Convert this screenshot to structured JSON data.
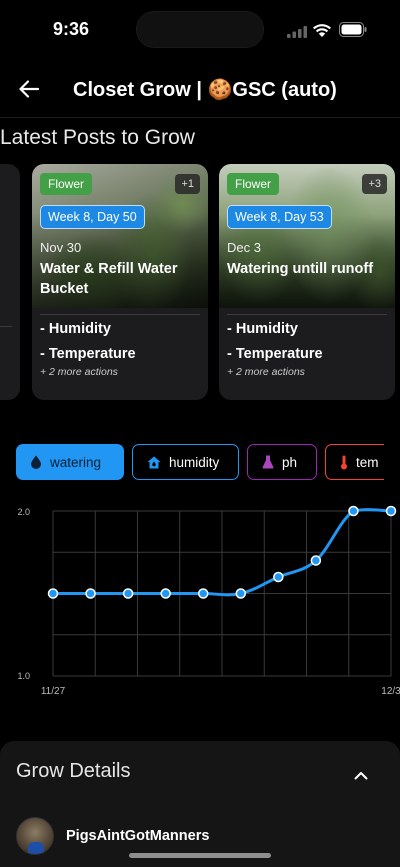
{
  "status_bar": {
    "time": "9:36"
  },
  "header": {
    "title": "Closet Grow | 🍪GSC (auto)"
  },
  "latest_posts": {
    "title": "Latest Posts to Grow",
    "posts": [
      {
        "stage": "Flower",
        "extra_photos": "+1",
        "week_day": "Week 8, Day 50",
        "date": "Nov 30",
        "title": "Water & Refill Water Bucket",
        "actions": [
          "- Humidity",
          "- Temperature"
        ],
        "more_actions": "+ 2 more actions"
      },
      {
        "stage": "Flower",
        "extra_photos": "+3",
        "week_day": "Week 8, Day 53",
        "date": "Dec 3",
        "title": "Watering untill runoff",
        "actions": [
          "- Humidity",
          "- Temperature"
        ],
        "more_actions": "+ 2 more actions"
      }
    ]
  },
  "metric_chips": [
    {
      "label": "watering",
      "icon": "water-drop-icon",
      "selected": true,
      "color": "#2196f3"
    },
    {
      "label": "humidity",
      "icon": "home-humidity-icon",
      "selected": false,
      "color": "#2196f3"
    },
    {
      "label": "ph",
      "icon": "flask-icon",
      "selected": false,
      "color": "#9c27b0"
    },
    {
      "label": "tem",
      "icon": "thermometer-icon",
      "selected": false,
      "color": "#f44336"
    }
  ],
  "chart_data": {
    "type": "line",
    "series": [
      {
        "values": [
          1.5,
          1.5,
          1.5,
          1.5,
          1.5,
          1.5,
          1.6,
          1.7,
          2.0,
          2.0
        ]
      }
    ],
    "x": [
      0,
      1,
      2,
      3,
      4,
      5,
      6,
      7,
      8,
      9
    ],
    "xtick_labels": [
      "11/27",
      "12/3"
    ],
    "ytick_labels": [
      "2.0",
      "1.0"
    ],
    "ylim": [
      1.0,
      2.0
    ],
    "grid": true,
    "line_color": "#2196f3"
  },
  "grow_details": {
    "title": "Grow Details",
    "username": "PigsAintGotManners"
  }
}
